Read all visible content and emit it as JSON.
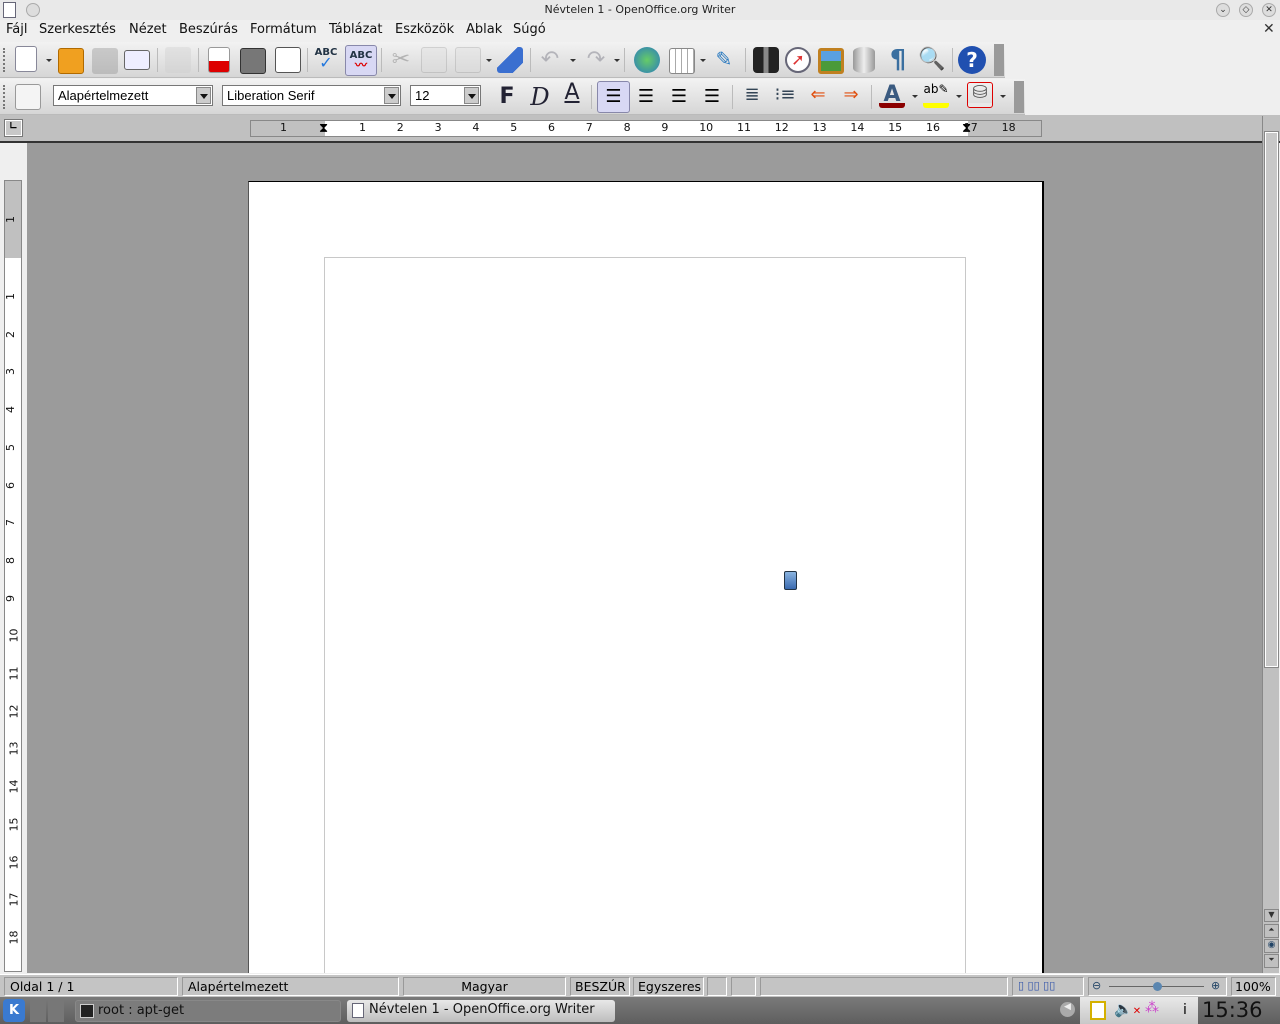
{
  "window": {
    "title": "Névtelen 1 - OpenOffice.org Writer"
  },
  "menu": [
    "Fájl",
    "Szerkesztés",
    "Nézet",
    "Beszúrás",
    "Formátum",
    "Táblázat",
    "Eszközök",
    "Ablak",
    "Súgó"
  ],
  "standard_toolbar": [
    "new-document",
    "open",
    "save",
    "email-document",
    "edit-file",
    "export-pdf",
    "print",
    "page-preview",
    "spellcheck",
    "autospellcheck",
    "cut",
    "copy",
    "paste",
    "clone-formatting",
    "undo",
    "redo",
    "hyperlink",
    "table",
    "show-draw-functions",
    "find-replace",
    "navigator",
    "gallery",
    "data-sources",
    "nonprinting-characters",
    "zoom",
    "help"
  ],
  "formatting": {
    "paragraph_style": "Alapértelmezett",
    "font_name": "Liberation Serif",
    "font_size": "12",
    "bold_label": "F",
    "italic_label": "D",
    "underline_label": "A",
    "active_alignment": "left",
    "font_color": "#8b0000",
    "highlight_color": "#ffff00",
    "background_color": "#e8e8e8"
  },
  "ruler": {
    "horizontal": [
      "1",
      "1",
      "2",
      "3",
      "4",
      "5",
      "6",
      "7",
      "8",
      "9",
      "10",
      "11",
      "12",
      "13",
      "14",
      "15",
      "16",
      "17",
      "18"
    ],
    "vertical": [
      "1",
      "1",
      "2",
      "3",
      "4",
      "5",
      "6",
      "7",
      "8",
      "9",
      "10",
      "11",
      "12",
      "13",
      "14",
      "15",
      "16",
      "17",
      "18"
    ]
  },
  "statusbar": {
    "page": "Oldal 1 / 1",
    "style": "Alapértelmezett",
    "language": "Magyar",
    "insert_mode": "BESZÚR",
    "selection_mode": "Egyszeres",
    "zoom": "100%",
    "zoom_level": 0.5
  },
  "taskbar": {
    "tasks": [
      "root : apt-get",
      "Névtelen 1 - OpenOffice.org Writer"
    ],
    "clock": "15:36",
    "info": "i"
  }
}
